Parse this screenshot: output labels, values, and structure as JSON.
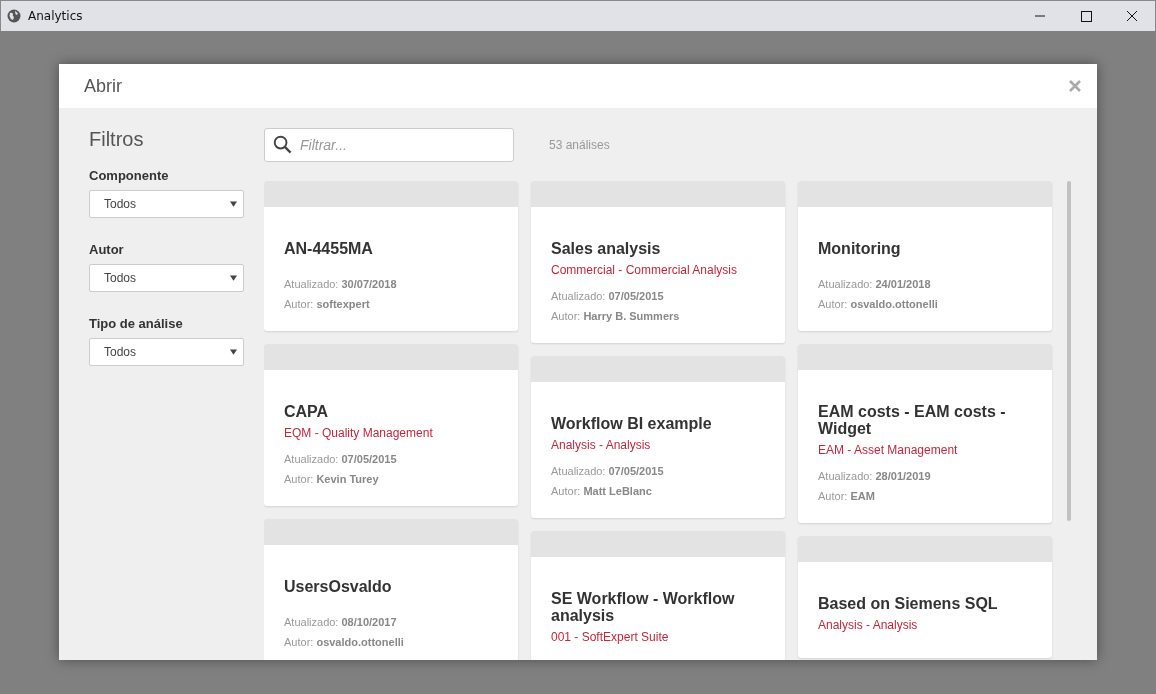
{
  "window": {
    "title": "Analytics"
  },
  "dialog": {
    "title": "Abrir",
    "filters": {
      "heading": "Filtros",
      "groups": [
        {
          "label": "Componente",
          "value": "Todos"
        },
        {
          "label": "Autor",
          "value": "Todos"
        },
        {
          "label": "Tipo de análise",
          "value": "Todos"
        }
      ]
    },
    "search": {
      "placeholder": "Filtrar..."
    },
    "count": "53 análises",
    "columns": [
      {
        "cards": [
          {
            "title": "AN-4455MA",
            "updated_label": "Atualizado:",
            "updated": "30/07/2018",
            "author_label": "Autor:",
            "author": "softexpert"
          },
          {
            "title": "CAPA",
            "subtitle": "EQM - Quality Management",
            "updated_label": "Atualizado:",
            "updated": "07/05/2015",
            "author_label": "Autor:",
            "author": "Kevin Turey"
          },
          {
            "title": "UsersOsvaldo",
            "updated_label": "Atualizado:",
            "updated": "08/10/2017",
            "author_label": "Autor:",
            "author": "osvaldo.ottonelli"
          }
        ]
      },
      {
        "cards": [
          {
            "title": "Sales analysis",
            "subtitle": "Commercial - Commercial Analysis",
            "updated_label": "Atualizado:",
            "updated": "07/05/2015",
            "author_label": "Autor:",
            "author": "Harry B. Summers"
          },
          {
            "title": "Workflow BI example",
            "subtitle": "Analysis - Analysis",
            "updated_label": "Atualizado:",
            "updated": "07/05/2015",
            "author_label": "Autor:",
            "author": "Matt LeBlanc"
          },
          {
            "title": "SE Workflow - Workflow analysis",
            "subtitle": "001 - SoftExpert Suite"
          }
        ]
      },
      {
        "cards": [
          {
            "title": "Monitoring",
            "updated_label": "Atualizado:",
            "updated": "24/01/2018",
            "author_label": "Autor:",
            "author": "osvaldo.ottonelli"
          },
          {
            "title": "EAM costs - EAM costs - Widget",
            "subtitle": "EAM - Asset Management",
            "updated_label": "Atualizado:",
            "updated": "28/01/2019",
            "author_label": "Autor:",
            "author": "EAM"
          },
          {
            "title": "Based on Siemens SQL",
            "subtitle": "Analysis - Analysis"
          }
        ]
      }
    ]
  }
}
